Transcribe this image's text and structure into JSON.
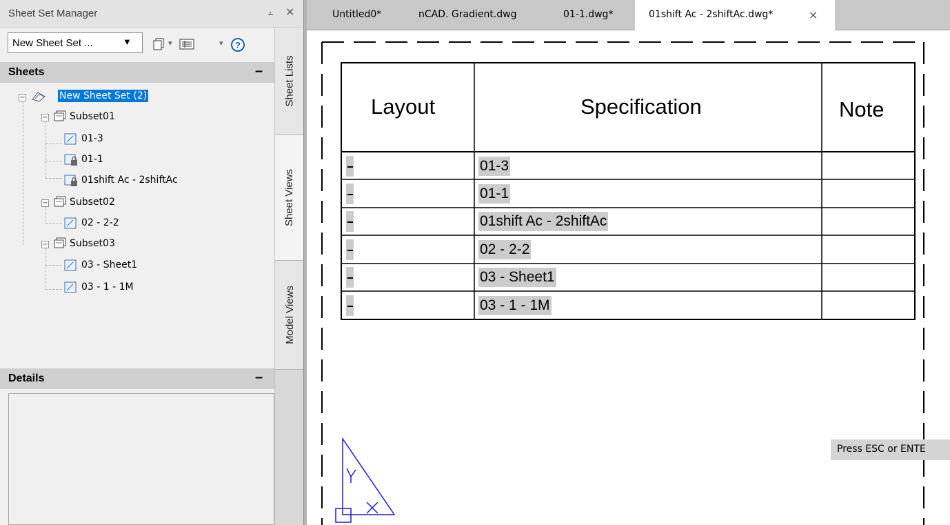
{
  "panel": {
    "title": "Sheet Set Manager",
    "pin_icon": "pin-icon",
    "close_icon": "close-icon",
    "combo_value": "New Sheet Set ...",
    "tabs": [
      "Sheet Lists",
      "Sheet Views",
      "Model Views"
    ],
    "sheets_header": "Sheets",
    "details_header": "Details",
    "collapse_symbol": "–"
  },
  "tree": {
    "root": "New Sheet Set (2)",
    "subsets": [
      {
        "name": "Subset01",
        "sheets": [
          "01-3",
          "01-1",
          "01shift Ac - 2shiftAc"
        ]
      },
      {
        "name": "Subset02",
        "sheets": [
          "02 - 2-2"
        ]
      },
      {
        "name": "Subset03",
        "sheets": [
          "03 - Sheet1",
          "03 - 1 - 1M"
        ]
      }
    ]
  },
  "doc_tabs": [
    "Untitled0*",
    "nCAD. Gradient.dwg",
    "01-1.dwg*",
    "01shift Ac - 2shiftAc.dwg*"
  ],
  "doc_tab_close": "×",
  "table": {
    "headers": [
      "Layout",
      "Specification",
      "Note"
    ],
    "rows": [
      "01-3",
      "01-1",
      "01shift Ac - 2shiftAc",
      "02 - 2-2",
      "03 - Sheet1",
      "03 - 1 - 1M"
    ]
  },
  "status_text": "Press ESC or ENTE",
  "colors": {
    "selection": "#0078d7",
    "ucs": "#1c1cd6",
    "field_bg": "#cccccc"
  }
}
